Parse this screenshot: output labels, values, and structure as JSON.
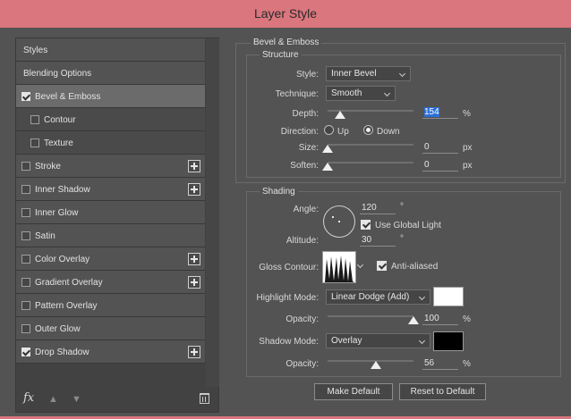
{
  "window": {
    "title": "Layer Style"
  },
  "nav": {
    "items": [
      {
        "label": "Styles",
        "checkbox": false,
        "checked": false,
        "plus": false,
        "sub": false,
        "selected": false
      },
      {
        "label": "Blending Options",
        "checkbox": false,
        "checked": false,
        "plus": false,
        "sub": false,
        "selected": false
      },
      {
        "label": "Bevel & Emboss",
        "checkbox": true,
        "checked": true,
        "plus": false,
        "sub": false,
        "selected": true
      },
      {
        "label": "Contour",
        "checkbox": true,
        "checked": false,
        "plus": false,
        "sub": true,
        "selected": false
      },
      {
        "label": "Texture",
        "checkbox": true,
        "checked": false,
        "plus": false,
        "sub": true,
        "selected": false
      },
      {
        "label": "Stroke",
        "checkbox": true,
        "checked": false,
        "plus": true,
        "sub": false,
        "selected": false
      },
      {
        "label": "Inner Shadow",
        "checkbox": true,
        "checked": false,
        "plus": true,
        "sub": false,
        "selected": false
      },
      {
        "label": "Inner Glow",
        "checkbox": true,
        "checked": false,
        "plus": false,
        "sub": false,
        "selected": false
      },
      {
        "label": "Satin",
        "checkbox": true,
        "checked": false,
        "plus": false,
        "sub": false,
        "selected": false
      },
      {
        "label": "Color Overlay",
        "checkbox": true,
        "checked": false,
        "plus": true,
        "sub": false,
        "selected": false
      },
      {
        "label": "Gradient Overlay",
        "checkbox": true,
        "checked": false,
        "plus": true,
        "sub": false,
        "selected": false
      },
      {
        "label": "Pattern Overlay",
        "checkbox": true,
        "checked": false,
        "plus": false,
        "sub": false,
        "selected": false
      },
      {
        "label": "Outer Glow",
        "checkbox": true,
        "checked": false,
        "plus": false,
        "sub": false,
        "selected": false
      },
      {
        "label": "Drop Shadow",
        "checkbox": true,
        "checked": true,
        "plus": true,
        "sub": false,
        "selected": false
      }
    ],
    "footer": {
      "fx_label": "fx"
    }
  },
  "bevel": {
    "group_title": "Bevel & Emboss",
    "structure_title": "Structure",
    "style_label": "Style:",
    "style_value": "Inner Bevel",
    "technique_label": "Technique:",
    "technique_value": "Smooth",
    "depth_label": "Depth:",
    "depth_value": "154",
    "depth_unit": "%",
    "direction_label": "Direction:",
    "direction_up": "Up",
    "direction_down": "Down",
    "size_label": "Size:",
    "size_value": "0",
    "size_unit": "px",
    "soften_label": "Soften:",
    "soften_value": "0",
    "soften_unit": "px"
  },
  "shading": {
    "title": "Shading",
    "angle_label": "Angle:",
    "angle_value": "120",
    "degree_symbol": "°",
    "use_global_light": "Use Global Light",
    "altitude_label": "Altitude:",
    "altitude_value": "30",
    "gloss_contour_label": "Gloss Contour:",
    "anti_aliased": "Anti-aliased",
    "highlight_mode_label": "Highlight Mode:",
    "highlight_mode_value": "Linear Dodge (Add)",
    "highlight_color": "#ffffff",
    "highlight_opacity_label": "Opacity:",
    "highlight_opacity_value": "100",
    "highlight_opacity_unit": "%",
    "shadow_mode_label": "Shadow Mode:",
    "shadow_mode_value": "Overlay",
    "shadow_color": "#000000",
    "shadow_opacity_label": "Opacity:",
    "shadow_opacity_value": "56",
    "shadow_opacity_unit": "%"
  },
  "buttons": {
    "make_default": "Make Default",
    "reset_default": "Reset to Default"
  },
  "colors": {
    "titlebar": "#da767d",
    "panel": "#535353",
    "selection": "#2b6fd6"
  }
}
